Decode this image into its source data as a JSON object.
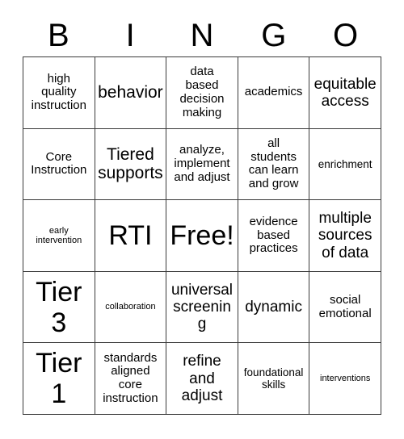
{
  "card": {
    "title_letters": [
      "B",
      "I",
      "N",
      "G",
      "O"
    ],
    "columns": 5,
    "rows": 5,
    "free_space": "Free!",
    "background_color": "#ffffff",
    "border_color": "#3a3a3a",
    "text_color": "#000000",
    "cells": [
      {
        "text": "high\nquality\ninstruction",
        "size": "fs-md"
      },
      {
        "text": "behavior",
        "size": "fs-xl"
      },
      {
        "text": "data\nbased\ndecision\nmaking",
        "size": "fs-md"
      },
      {
        "text": "academics",
        "size": "fs-md"
      },
      {
        "text": "equitable\naccess",
        "size": "fs-lg"
      },
      {
        "text": "Core\nInstruction",
        "size": "fs-md"
      },
      {
        "text": "Tiered\nsupports",
        "size": "fs-xl"
      },
      {
        "text": "analyze,\nimplement\nand adjust",
        "size": "fs-md"
      },
      {
        "text": "all\nstudents\ncan learn\nand grow",
        "size": "fs-md"
      },
      {
        "text": "enrichment",
        "size": "fs-sm"
      },
      {
        "text": "early\nintervention",
        "size": "fs-xs"
      },
      {
        "text": "RTI",
        "size": "fs-xxl"
      },
      {
        "text": "Free!",
        "size": "fs-xxl"
      },
      {
        "text": "evidence\nbased\npractices",
        "size": "fs-md"
      },
      {
        "text": "multiple\nsources\nof data",
        "size": "fs-lg"
      },
      {
        "text": "Tier\n3",
        "size": "fs-xxl"
      },
      {
        "text": "collaboration",
        "size": "fs-xs"
      },
      {
        "text": "universal\nscreening",
        "size": "fs-lg"
      },
      {
        "text": "dynamic",
        "size": "fs-lg"
      },
      {
        "text": "social\nemotional",
        "size": "fs-md"
      },
      {
        "text": "Tier\n1",
        "size": "fs-xxl"
      },
      {
        "text": "standards\naligned\ncore\ninstruction",
        "size": "fs-md"
      },
      {
        "text": "refine\nand\nadjust",
        "size": "fs-lg"
      },
      {
        "text": "foundational\nskills",
        "size": "fs-sm"
      },
      {
        "text": "interventions",
        "size": "fs-xs"
      }
    ]
  }
}
